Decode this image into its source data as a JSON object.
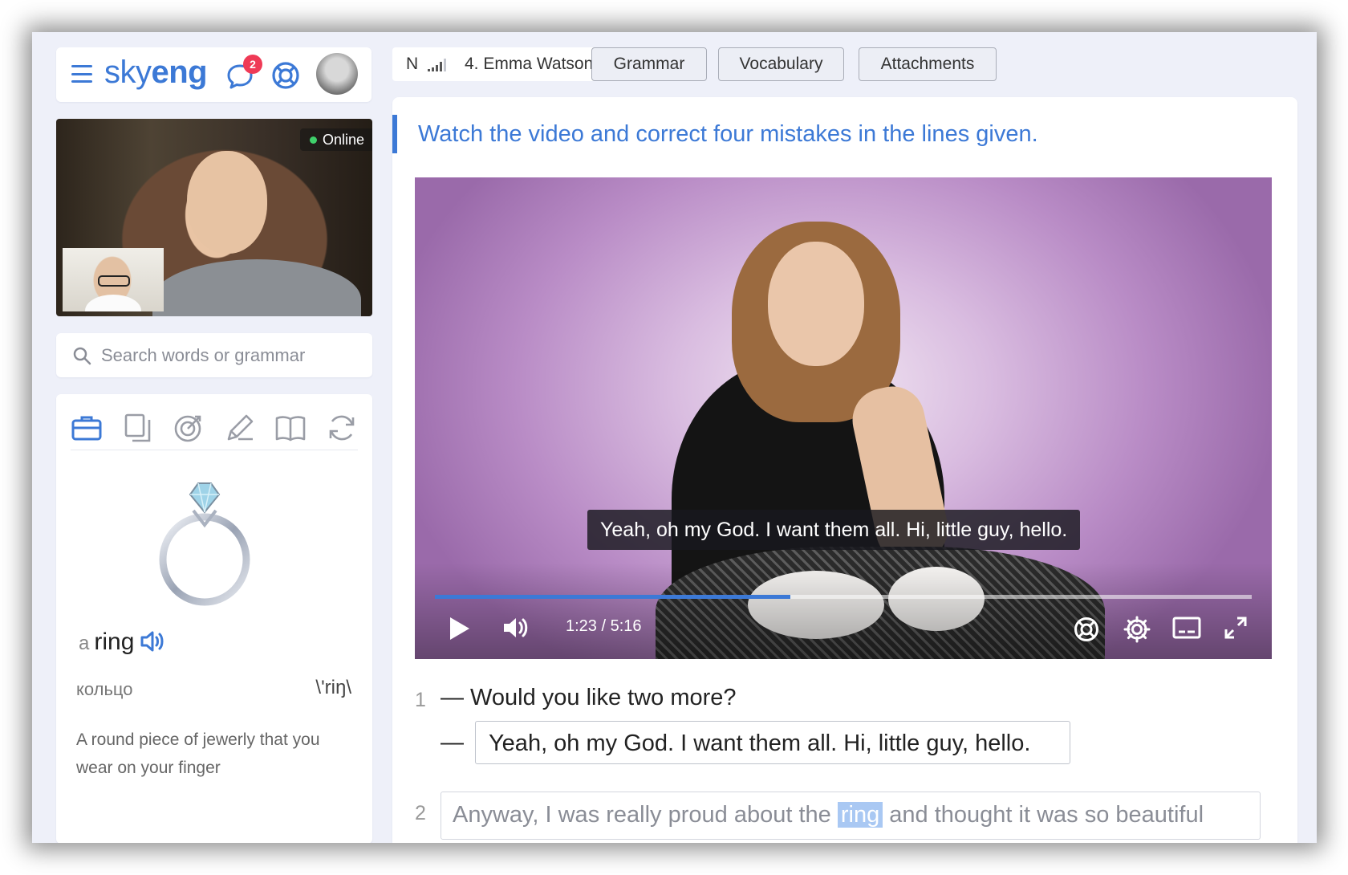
{
  "header": {
    "logo_light": "sky",
    "logo_bold": "eng",
    "chat_badge": "2"
  },
  "video_call": {
    "status": "Online"
  },
  "search": {
    "placeholder": "Search words or grammar"
  },
  "toolbar": {
    "icons": [
      "briefcase-icon",
      "copy-icon",
      "target-icon",
      "pencil-icon",
      "book-icon",
      "refresh-icon"
    ],
    "active": "briefcase-icon"
  },
  "dictionary": {
    "article": "a",
    "word": "ring",
    "translation": "кольцо",
    "ipa": "\\'riŋ\\",
    "definition": "A round piece of jewerly that you wear on your finger"
  },
  "lesson": {
    "signal_label": "N",
    "title": "4. Emma Watson",
    "tabs": [
      "Grammar",
      "Vocabulary",
      "Attachments"
    ]
  },
  "main": {
    "instruction": "Watch the video and correct four mistakes in the lines given."
  },
  "player": {
    "caption": "Yeah, oh my God. I want them all. Hi, little guy, hello.",
    "time": "1:23 / 5:16",
    "progress": 0.435
  },
  "exercise": {
    "items": [
      {
        "number": "1",
        "dash": "—",
        "prompt": "— Would you like two more?",
        "answer": "Yeah, oh my God. I want them all. Hi, little guy, hello."
      },
      {
        "number": "2",
        "answer_before": "Anyway, I was really proud about the",
        "highlight": "ring",
        "answer_after": "and thought it was so beautiful"
      }
    ]
  },
  "colors": {
    "accent": "#3c79d6",
    "badge": "#ef3a56",
    "online": "#3fd06b",
    "background": "#eef0f9"
  }
}
